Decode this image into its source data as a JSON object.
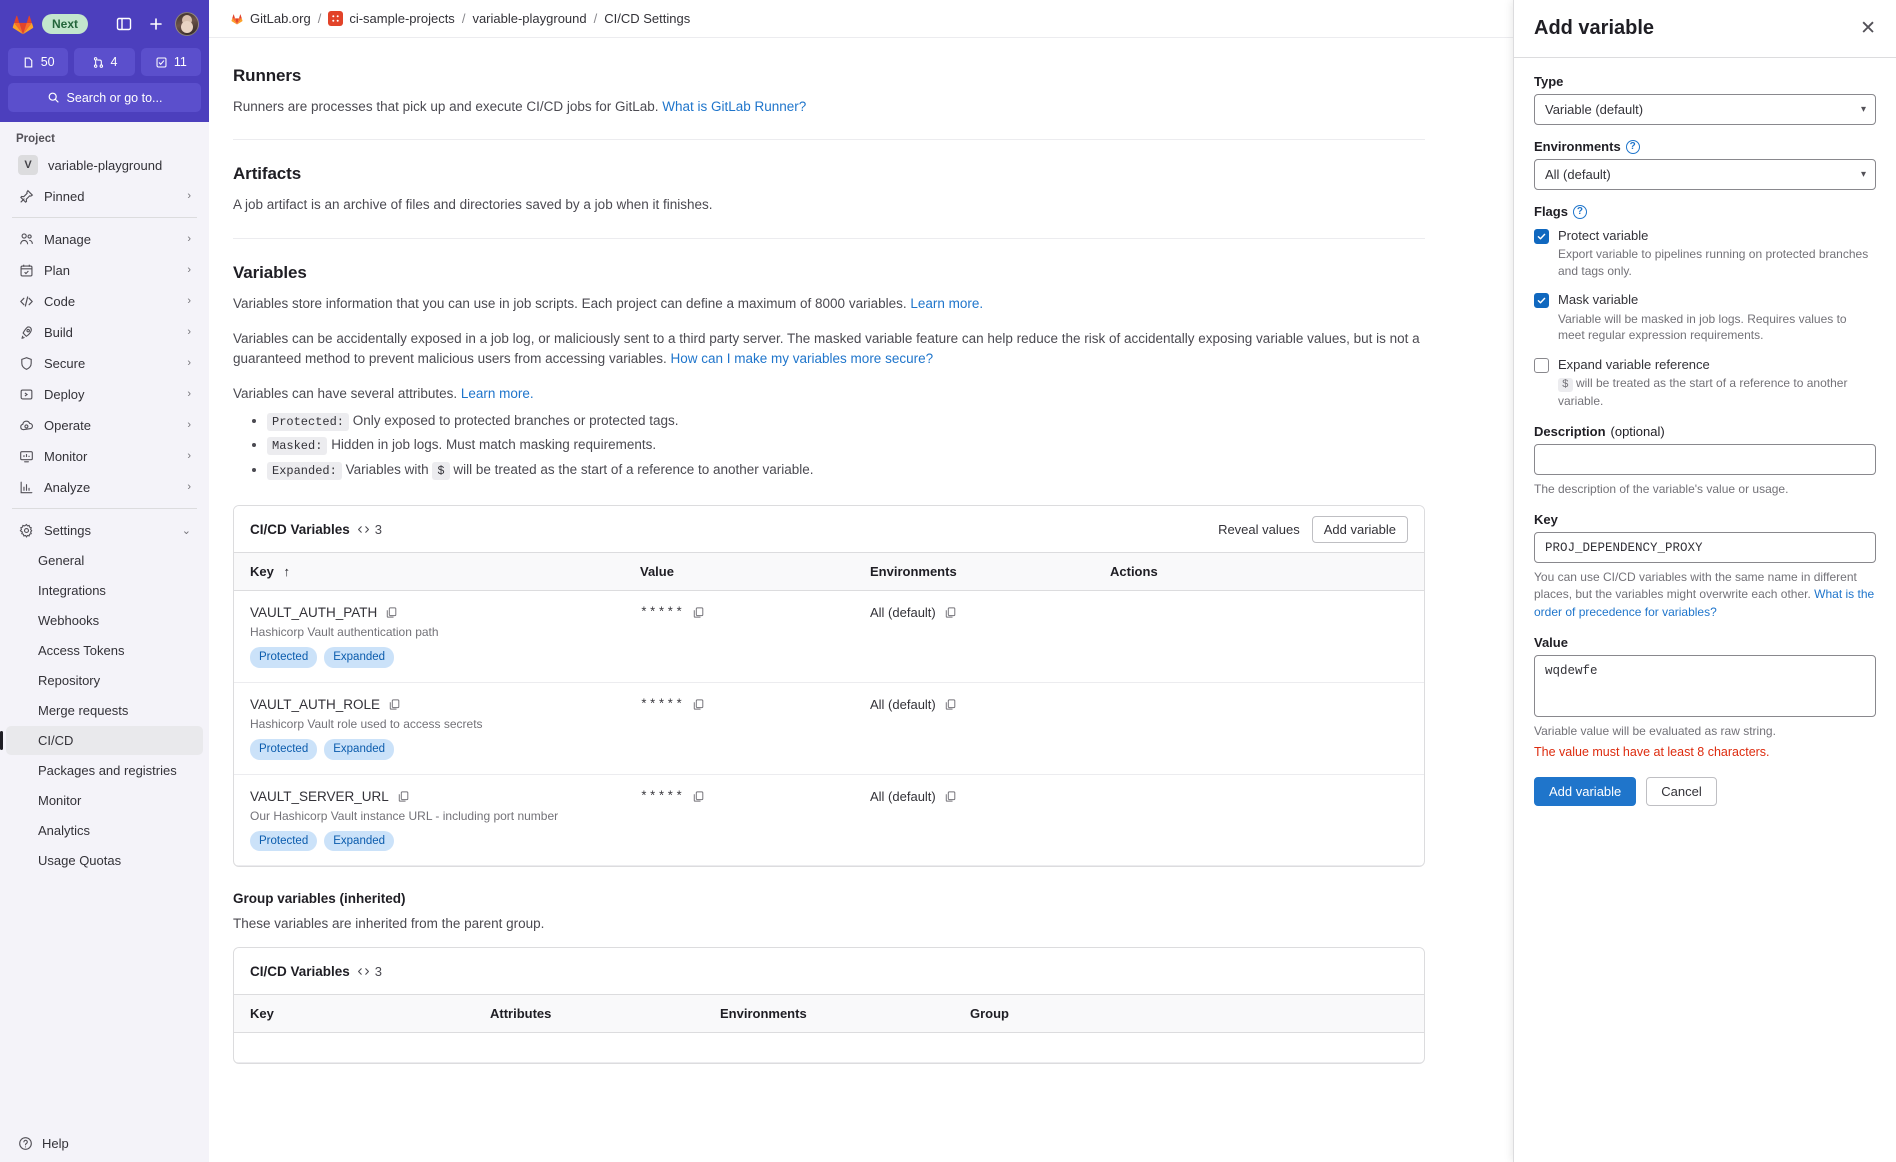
{
  "sidebar": {
    "brand": {
      "logo_icon": "gitlab-logo-icon",
      "next_badge": "Next"
    },
    "top_icons": [
      {
        "name": "toggle-sidebar-icon",
        "label": ""
      },
      {
        "name": "create-new-icon",
        "label": "+"
      }
    ],
    "counters": [
      {
        "icon": "merge-requests-todo-icon",
        "value": "50"
      },
      {
        "icon": "merge-request-icon",
        "value": "4"
      },
      {
        "icon": "todo-done-icon",
        "value": "11"
      }
    ],
    "search": {
      "label": "Search or go to...",
      "icon": "search-icon"
    },
    "project_section_label": "Project",
    "project": {
      "initial": "V",
      "name": "variable-playground"
    },
    "items": [
      {
        "label": "Pinned",
        "icon": "pin-icon",
        "expandable": true
      },
      {
        "label": "Manage",
        "icon": "users-icon",
        "expandable": true
      },
      {
        "label": "Plan",
        "icon": "calendar-icon",
        "expandable": true
      },
      {
        "label": "Code",
        "icon": "code-icon",
        "expandable": true
      },
      {
        "label": "Build",
        "icon": "rocket-icon",
        "expandable": true
      },
      {
        "label": "Secure",
        "icon": "shield-icon",
        "expandable": true
      },
      {
        "label": "Deploy",
        "icon": "deploy-icon",
        "expandable": true
      },
      {
        "label": "Operate",
        "icon": "cloud-gear-icon",
        "expandable": true
      },
      {
        "label": "Monitor",
        "icon": "monitor-icon",
        "expandable": true
      },
      {
        "label": "Analyze",
        "icon": "chart-icon",
        "expandable": true
      }
    ],
    "settings": {
      "label": "Settings",
      "icon": "gear-icon",
      "expanded": true
    },
    "settings_items": [
      {
        "label": "General",
        "active": false
      },
      {
        "label": "Integrations",
        "active": false
      },
      {
        "label": "Webhooks",
        "active": false
      },
      {
        "label": "Access Tokens",
        "active": false
      },
      {
        "label": "Repository",
        "active": false
      },
      {
        "label": "Merge requests",
        "active": false
      },
      {
        "label": "CI/CD",
        "active": true
      },
      {
        "label": "Packages and registries",
        "active": false
      },
      {
        "label": "Monitor",
        "active": false
      },
      {
        "label": "Analytics",
        "active": false
      },
      {
        "label": "Usage Quotas",
        "active": false
      }
    ],
    "help": {
      "label": "Help",
      "icon": "help-icon"
    }
  },
  "breadcrumb": {
    "items": [
      {
        "label": "GitLab.org",
        "icon": "gitlab-group-icon"
      },
      {
        "label": "ci-sample-projects",
        "icon": "project-avatar-icon"
      },
      {
        "label": "variable-playground",
        "icon": null
      },
      {
        "label": "CI/CD Settings",
        "icon": null,
        "current": true
      }
    ],
    "separator": "/"
  },
  "main": {
    "runners": {
      "title": "Runners",
      "desc": "Runners are processes that pick up and execute CI/CD jobs for GitLab.",
      "link": "What is GitLab Runner?"
    },
    "artifacts": {
      "title": "Artifacts",
      "desc": "A job artifact is an archive of files and directories saved by a job when it finishes."
    },
    "variables": {
      "title": "Variables",
      "desc1": "Variables store information that you can use in job scripts. Each project can define a maximum of 8000 variables.",
      "desc1_link": "Learn more.",
      "desc2": "Variables can be accidentally exposed in a job log, or maliciously sent to a third party server. The masked variable feature can help reduce the risk of accidentally exposing variable values, but is not a guaranteed method to prevent malicious users from accessing variables.",
      "desc2_link": "How can I make my variables more secure?",
      "desc3": "Variables can have several attributes.",
      "desc3_link": "Learn more.",
      "attributes": [
        {
          "code": "Protected:",
          "text": "Only exposed to protected branches or protected tags."
        },
        {
          "code": "Masked:",
          "text": "Hidden in job logs. Must match masking requirements."
        },
        {
          "code": "Expanded:",
          "text_before": "Variables with",
          "inline_code": "$",
          "text_after": "will be treated as the start of a reference to another variable."
        }
      ]
    },
    "project_vars_card": {
      "title": "CI/CD Variables",
      "count": "3",
      "count_icon": "code-icon",
      "reveal_label": "Reveal values",
      "add_button": "Add variable",
      "columns": [
        "Key",
        "Value",
        "Environments",
        "Actions"
      ],
      "sort_indicator": "↑",
      "rows": [
        {
          "key": "VAULT_AUTH_PATH",
          "description": "Hashicorp Vault authentication path",
          "badges": [
            "Protected",
            "Expanded"
          ],
          "value": "*****",
          "environment": "All (default)"
        },
        {
          "key": "VAULT_AUTH_ROLE",
          "description": "Hashicorp Vault role used to access secrets",
          "badges": [
            "Protected",
            "Expanded"
          ],
          "value": "*****",
          "environment": "All (default)"
        },
        {
          "key": "VAULT_SERVER_URL",
          "description": "Our Hashicorp Vault instance URL - including port number",
          "badges": [
            "Protected",
            "Expanded"
          ],
          "value": "*****",
          "environment": "All (default)"
        }
      ]
    },
    "group_vars": {
      "heading": "Group variables (inherited)",
      "subtext": "These variables are inherited from the parent group.",
      "card_title": "CI/CD Variables",
      "card_count": "3",
      "columns": [
        "Key",
        "Attributes",
        "Environments",
        "Group"
      ]
    }
  },
  "drawer": {
    "title": "Add variable",
    "close_icon": "close-icon",
    "type": {
      "label": "Type",
      "value": "Variable (default)"
    },
    "environments": {
      "label": "Environments",
      "value": "All (default)",
      "help_icon": "question-icon"
    },
    "flags": {
      "label": "Flags",
      "help_icon": "question-icon",
      "items": [
        {
          "label": "Protect variable",
          "checked": true,
          "desc": "Export variable to pipelines running on protected branches and tags only."
        },
        {
          "label": "Mask variable",
          "checked": true,
          "desc": "Variable will be masked in job logs. Requires values to meet regular expression requirements."
        },
        {
          "label": "Expand variable reference",
          "checked": false,
          "desc_code": "$",
          "desc": "will be treated as the start of a reference to another variable."
        }
      ]
    },
    "description": {
      "label": "Description",
      "optional": "(optional)",
      "value": "",
      "help": "The description of the variable's value or usage."
    },
    "key": {
      "label": "Key",
      "value": "PROJ_DEPENDENCY_PROXY",
      "help": "You can use CI/CD variables with the same name in different places, but the variables might overwrite each other.",
      "help_link": "What is the order of precedence for variables?"
    },
    "value": {
      "label": "Value",
      "value": "wqdewfe",
      "help": "Variable value will be evaluated as raw string.",
      "error": "The value must have at least 8 characters."
    },
    "submit_button": "Add variable",
    "cancel_button": "Cancel"
  },
  "colors": {
    "brand_purple": "#4c3fbd",
    "link_blue": "#1f75cb",
    "badge_blue_bg": "#cbe2f9",
    "badge_blue_fg": "#0b5cad",
    "error_red": "#dd2b0e",
    "checkbox_blue": "#1068bf"
  }
}
